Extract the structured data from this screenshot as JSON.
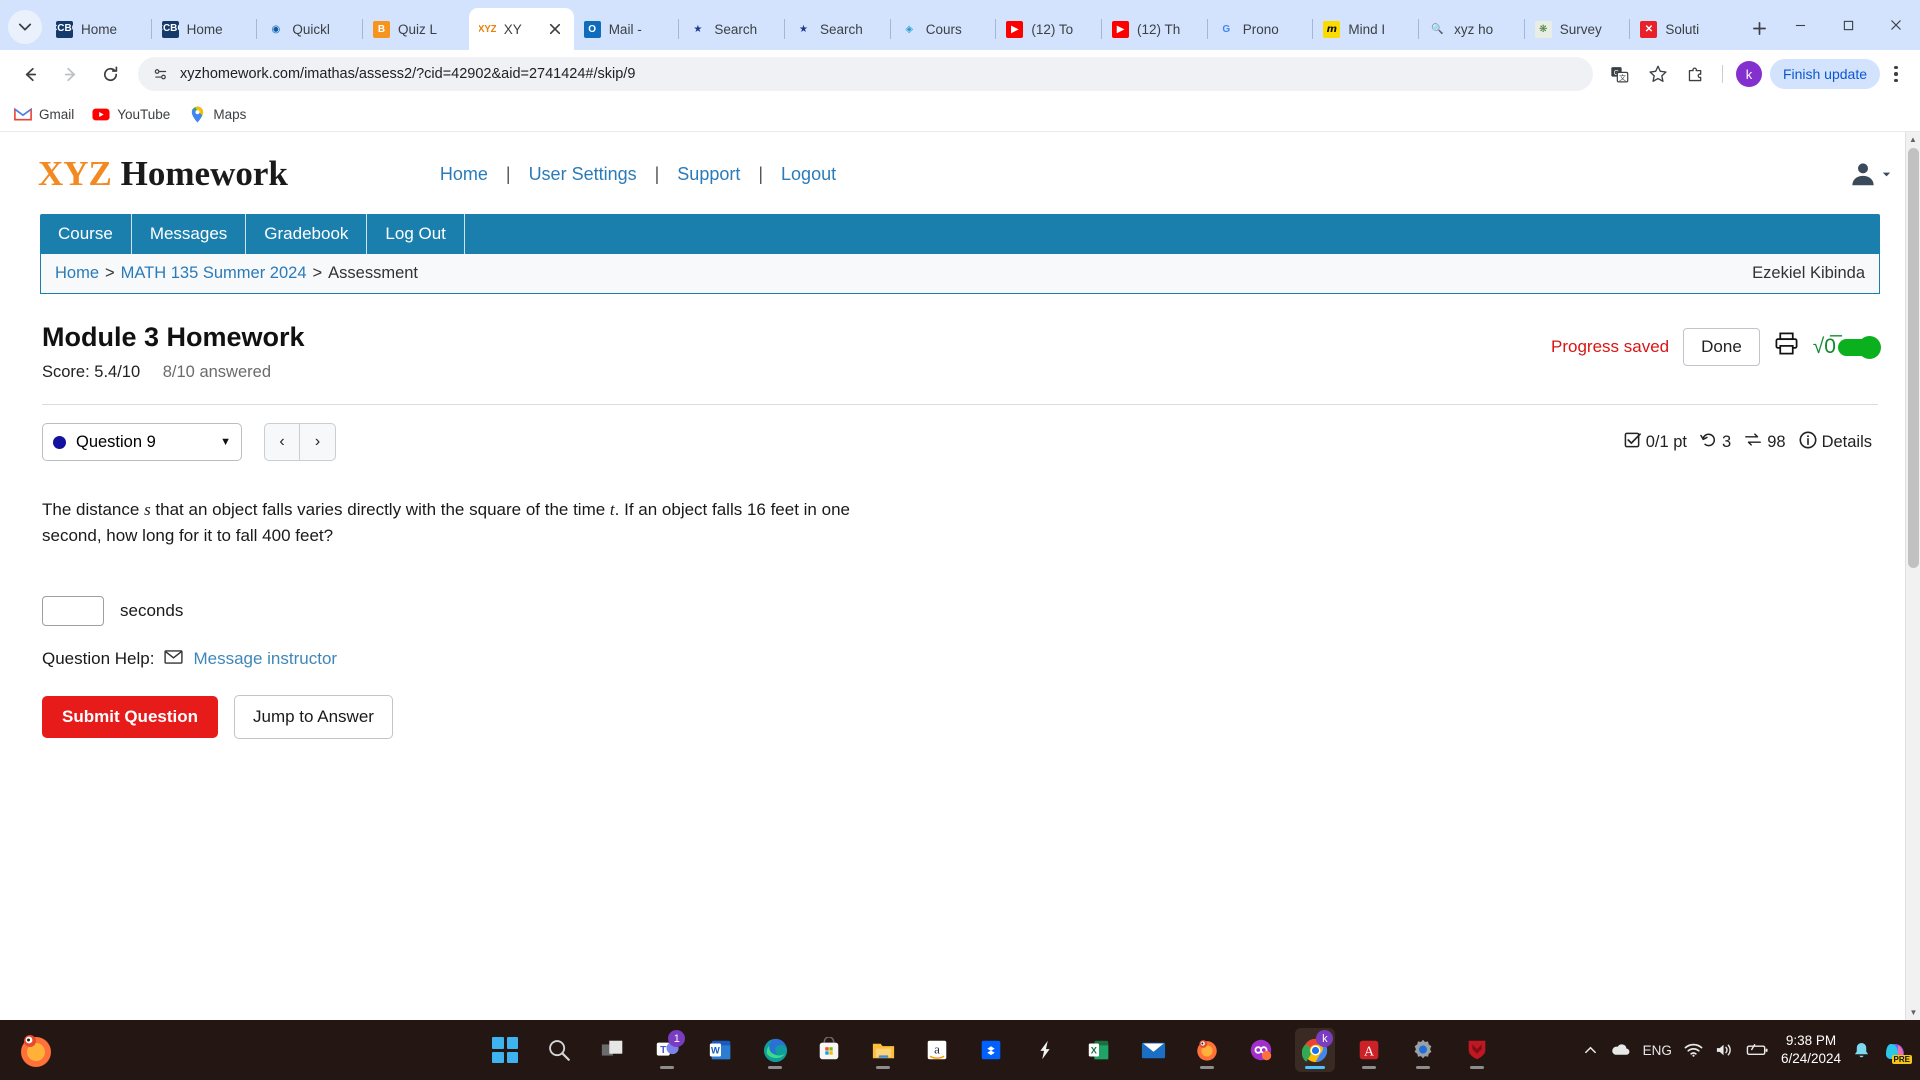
{
  "browser": {
    "tabs": [
      {
        "title": "Home",
        "icon": "ccbc-icon",
        "active": false
      },
      {
        "title": "Home",
        "icon": "ccbc-icon",
        "active": false
      },
      {
        "title": "Quickl",
        "icon": "quicklaunch-icon",
        "active": false
      },
      {
        "title": "Quiz L",
        "icon": "quizbot-icon",
        "active": false
      },
      {
        "title": "XY",
        "icon": "xyz-icon",
        "active": true
      },
      {
        "title": "Mail -",
        "icon": "outlook-icon",
        "active": false
      },
      {
        "title": "Search",
        "icon": "star-shield-icon",
        "active": false
      },
      {
        "title": "Search",
        "icon": "star-shield-icon",
        "active": false
      },
      {
        "title": "Cours",
        "icon": "canvas-icon",
        "active": false
      },
      {
        "title": "(12) To",
        "icon": "youtube-icon",
        "active": false
      },
      {
        "title": "(12) Th",
        "icon": "youtube-icon",
        "active": false
      },
      {
        "title": "Prono",
        "icon": "google-icon",
        "active": false
      },
      {
        "title": "Mind I",
        "icon": "mindtap-icon",
        "active": false
      },
      {
        "title": "xyz ho",
        "icon": "search-icon",
        "active": false
      },
      {
        "title": "Survey",
        "icon": "survey-icon",
        "active": false
      },
      {
        "title": "Soluti",
        "icon": "solution-icon",
        "active": false
      }
    ],
    "new_tab_label": "+",
    "url": "xyzhomework.com/imathas/assess2/?cid=42902&aid=2741424#/skip/9",
    "profile_initial": "k",
    "finish_update_label": "Finish update",
    "bookmarks": [
      {
        "label": "Gmail",
        "icon": "gmail-icon"
      },
      {
        "label": "YouTube",
        "icon": "youtube-icon"
      },
      {
        "label": "Maps",
        "icon": "maps-icon"
      }
    ]
  },
  "site": {
    "logo_accent": "XYZ",
    "logo_rest": "Homework",
    "accent_color": "#f28a21",
    "nav": [
      {
        "label": "Home"
      },
      {
        "label": "User Settings"
      },
      {
        "label": "Support"
      },
      {
        "label": "Logout"
      }
    ],
    "nav_separator": "|",
    "course_tabs": [
      {
        "label": "Course"
      },
      {
        "label": "Messages"
      },
      {
        "label": "Gradebook"
      },
      {
        "label": "Log Out"
      }
    ],
    "breadcrumb": {
      "home": "Home",
      "sep1": ">",
      "course": "MATH 135 Summer 2024",
      "sep2": ">",
      "current": "Assessment"
    },
    "student_name": "Ezekiel Kibinda",
    "tab_bar_color": "#1b7fae"
  },
  "assessment": {
    "title": "Module 3 Homework",
    "score_label": "Score: 5.4/10",
    "answered_label": "8/10 answered",
    "progress_saved": "Progress saved",
    "progress_saved_color": "#d81515",
    "done_label": "Done",
    "print_icon": "printer-icon",
    "math_toggle_icon": "radical-icon",
    "math_toggle_state": "on",
    "math_toggle_color": "#0bb01f"
  },
  "question_nav": {
    "selected_question": "Question 9",
    "prev_label": "‹",
    "next_label": "›",
    "dot_color": "#12129c",
    "stats": {
      "points": "0/1 pt",
      "attempts": "3",
      "views": "98",
      "details_label": "Details"
    }
  },
  "question": {
    "text_part1": "The distance ",
    "var_s": "s",
    "text_part2": " that an object falls varies directly with the square of the time ",
    "var_t": "t",
    "text_part3": ". If an object falls 16 feet in one second, how long for it to fall 400 feet?",
    "answer_value": "",
    "answer_unit": "seconds",
    "help_label": "Question Help:",
    "message_instructor": "Message instructor",
    "submit_label": "Submit Question",
    "jump_label": "Jump to Answer"
  },
  "taskbar": {
    "apps": [
      {
        "name": "start-button",
        "icon": "windows-icon"
      },
      {
        "name": "search-button",
        "icon": "search-icon"
      },
      {
        "name": "task-view-button",
        "icon": "task-view-icon"
      },
      {
        "name": "teams-app",
        "icon": "teams-icon",
        "badge": "1"
      },
      {
        "name": "word-app",
        "icon": "word-icon"
      },
      {
        "name": "edge-app",
        "icon": "edge-icon"
      },
      {
        "name": "store-app",
        "icon": "microsoft-store-icon"
      },
      {
        "name": "file-explorer-app",
        "icon": "folder-icon"
      },
      {
        "name": "amazon-app",
        "icon": "amazon-icon"
      },
      {
        "name": "dropbox-app",
        "icon": "dropbox-icon"
      },
      {
        "name": "lightning-app",
        "icon": "lightning-icon"
      },
      {
        "name": "excel-app",
        "icon": "excel-icon"
      },
      {
        "name": "mail-app",
        "icon": "mail-icon"
      },
      {
        "name": "firefox-app",
        "icon": "firefox-icon"
      },
      {
        "name": "infinity-app",
        "icon": "infinity-icon"
      },
      {
        "name": "chrome-app",
        "icon": "chrome-icon"
      },
      {
        "name": "acrobat-app",
        "icon": "acrobat-icon"
      },
      {
        "name": "settings-app",
        "icon": "gear-icon"
      },
      {
        "name": "mcafee-app",
        "icon": "mcafee-icon"
      }
    ],
    "language": "ENG",
    "time": "9:38 PM",
    "date": "6/24/2024",
    "copilot_badge": "PRE"
  }
}
